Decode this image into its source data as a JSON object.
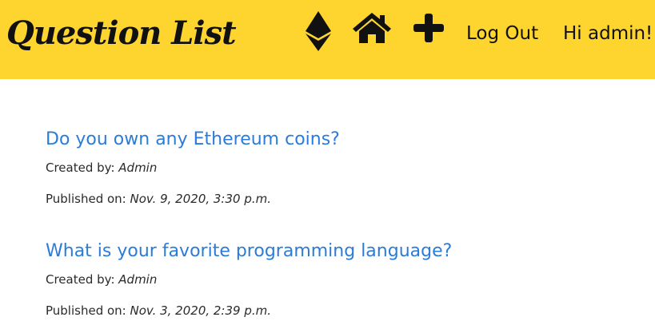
{
  "header": {
    "brand": "Question List",
    "nav": {
      "eth_icon": "ethereum-icon",
      "home_icon": "home-icon",
      "add_icon": "plus-icon",
      "logout_label": "Log Out",
      "greeting": "Hi admin!"
    },
    "background_color": "#fed52f"
  },
  "questions": [
    {
      "title": "Do you own any Ethereum coins?",
      "created_label": "Created by:",
      "author": "Admin",
      "published_label": "Published on:",
      "published": "Nov. 9, 2020, 3:30 p.m."
    },
    {
      "title": "What is your favorite programming language?",
      "created_label": "Created by:",
      "author": "Admin",
      "published_label": "Published on:",
      "published": "Nov. 3, 2020, 2:39 p.m."
    }
  ],
  "colors": {
    "link": "#2b7cd8",
    "text": "#2a2a2a"
  }
}
